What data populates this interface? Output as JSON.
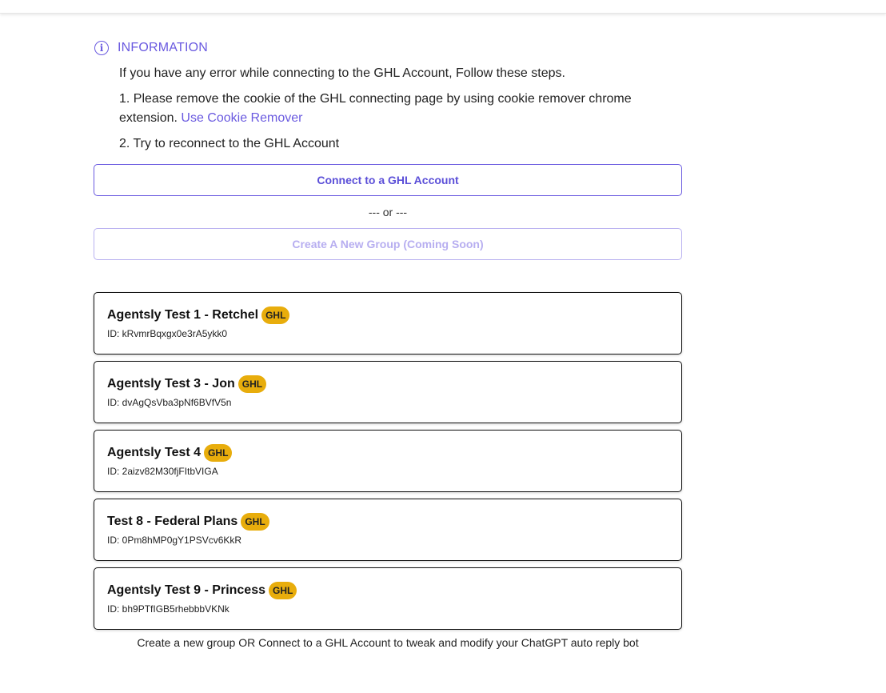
{
  "info": {
    "icon": "info-icon",
    "title": "INFORMATION",
    "intro": "If you have any error while connecting to the GHL Account, Follow these steps.",
    "step1_text": "1. Please remove the cookie of the GHL connecting page by using cookie remover chrome extension.",
    "step1_link": "Use Cookie Remover",
    "step2_text": "2. Try to reconnect to the GHL Account"
  },
  "actions": {
    "connect_label": "Connect to a GHL Account",
    "separator": "--- or ---",
    "create_group_label": "Create A New Group (Coming Soon)"
  },
  "groups": [
    {
      "name": "Agentsly Test 1 - Retchel",
      "badge": "GHL",
      "id": "ID: kRvmrBqxgx0e3rA5ykk0"
    },
    {
      "name": "Agentsly Test 3 - Jon",
      "badge": "GHL",
      "id": "ID: dvAgQsVba3pNf6BVfV5n"
    },
    {
      "name": "Agentsly Test 4",
      "badge": "GHL",
      "id": "ID: 2aizv82M30fjFItbVIGA"
    },
    {
      "name": "Test 8 - Federal Plans",
      "badge": "GHL",
      "id": "ID: 0Pm8hMP0gY1PSVcv6KkR"
    },
    {
      "name": "Agentsly Test 9 - Princess",
      "badge": "GHL",
      "id": "ID: bh9PTfIGB5rhebbbVKNk"
    }
  ],
  "footer": {
    "note": "Create a new group OR Connect to a GHL Account to tweak and modify your ChatGPT auto reply bot"
  },
  "colors": {
    "accent": "#6a5ae0",
    "badge": "#e8ad0c"
  }
}
